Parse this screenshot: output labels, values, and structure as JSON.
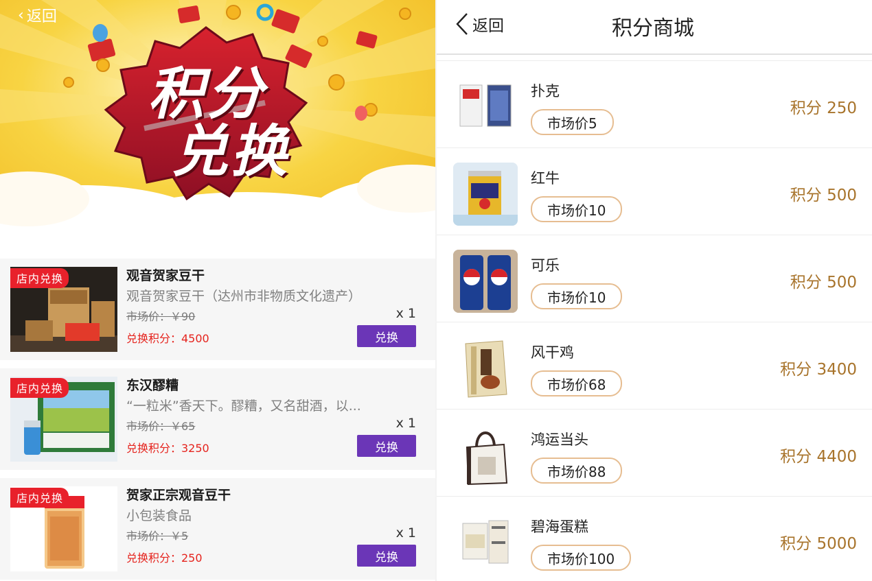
{
  "left": {
    "back_label": "返回",
    "banner": {
      "line1": "积分",
      "line2": "兑换"
    },
    "items": [
      {
        "tag": "店内兑换",
        "title": "观音贺家豆干",
        "desc": "观音贺家豆干（达州市非物质文化遗产）",
        "market": "市场价：￥90",
        "qty": "x 1",
        "points": "兑换积分：4500",
        "button": "兑换"
      },
      {
        "tag": "店内兑换",
        "title": "东汉醪糟",
        "desc": "“一粒米”香天下。醪糟，又名甜酒，以...",
        "market": "市场价：￥65",
        "qty": "x 1",
        "points": "兑换积分：3250",
        "button": "兑换"
      },
      {
        "tag": "店内兑换",
        "title": "贺家正宗观音豆干",
        "desc": "小包装食品",
        "market": "市场价：￥5",
        "qty": "x 1",
        "points": "兑换积分：250",
        "button": "兑换"
      }
    ]
  },
  "right": {
    "back_label": "返回",
    "title": "积分商城",
    "items": [
      {
        "name": "扑克",
        "market": "市场价5",
        "points": "积分 250"
      },
      {
        "name": "红牛",
        "market": "市场价10",
        "points": "积分 500"
      },
      {
        "name": "可乐",
        "market": "市场价10",
        "points": "积分 500"
      },
      {
        "name": "风干鸡",
        "market": "市场价68",
        "points": "积分 3400"
      },
      {
        "name": "鸿运当头",
        "market": "市场价88",
        "points": "积分 4400"
      },
      {
        "name": "碧海蛋糕",
        "market": "市场价100",
        "points": "积分 5000"
      }
    ]
  },
  "colors": {
    "accent_purple": "#6b36b7",
    "tag_red": "#e8212b",
    "points_gold": "#a8742c",
    "pill_border": "#e6bd91"
  }
}
